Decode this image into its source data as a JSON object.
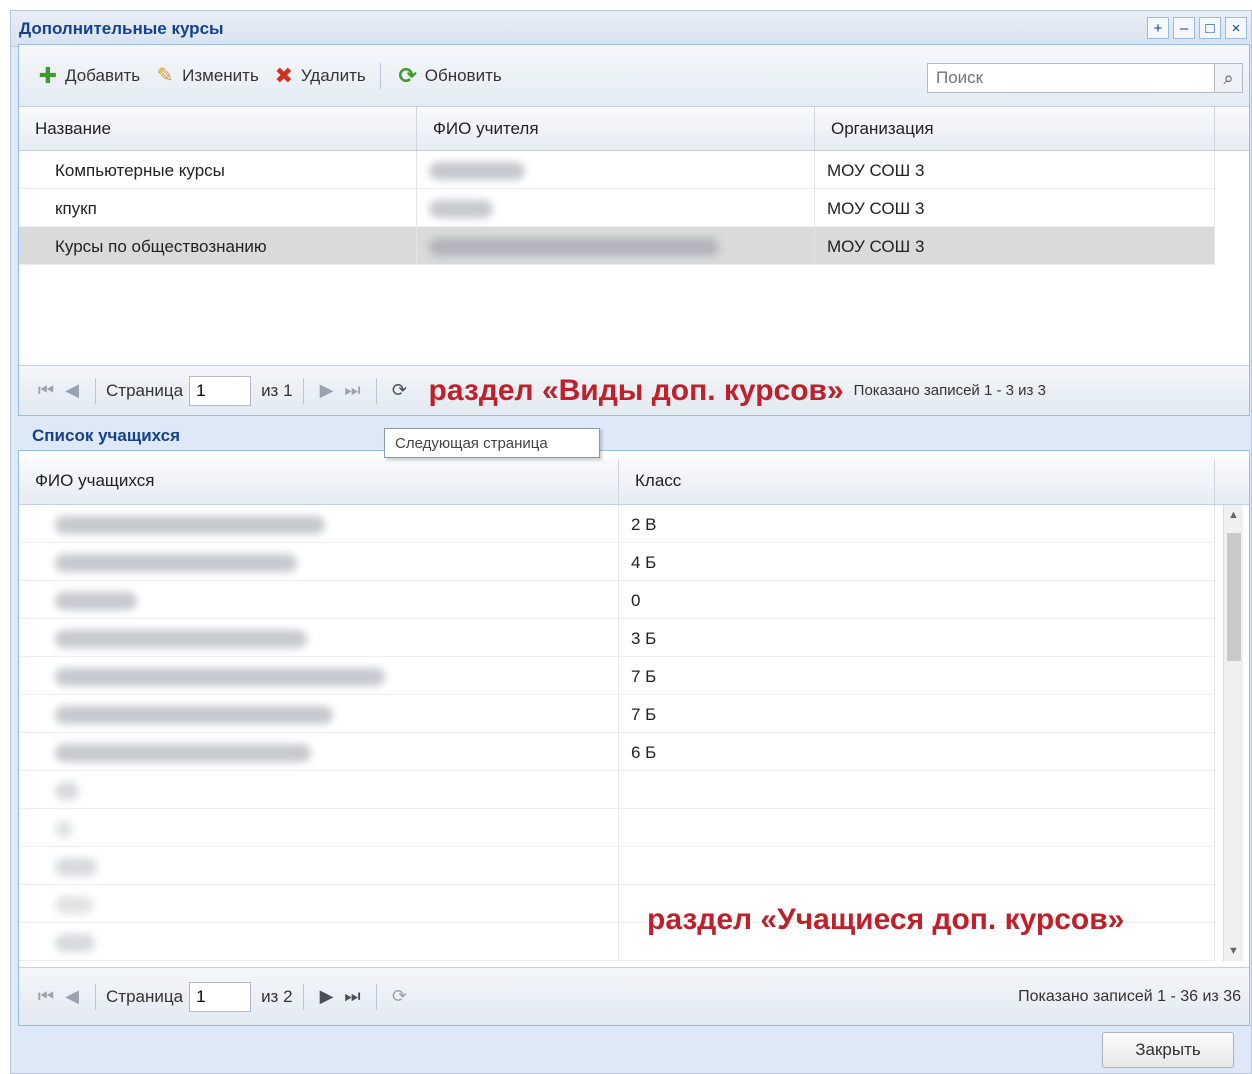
{
  "window": {
    "title": "Дополнительные курсы",
    "tools": [
      "+",
      "–",
      "□",
      "×"
    ]
  },
  "toolbar": {
    "add_label": "Добавить",
    "edit_label": "Изменить",
    "delete_label": "Удалить",
    "refresh_label": "Обновить",
    "search_placeholder": "Поиск"
  },
  "courses_grid": {
    "columns": [
      "Название",
      "ФИО учителя",
      "Организация"
    ],
    "rows": [
      {
        "name": "Компьютерные курсы",
        "org": "МОУ СОШ 3",
        "selected": false
      },
      {
        "name": "кпукп",
        "org": "МОУ СОШ 3",
        "selected": false
      },
      {
        "name": "Курсы по обществознанию",
        "org": "МОУ СОШ 3",
        "selected": true
      }
    ],
    "pager": {
      "page_label": "Страница",
      "page_value": "1",
      "of_label": "из 1",
      "info": "Показано записей 1 - 3 из 3"
    }
  },
  "annotation_top": "раздел «Виды доп. курсов»",
  "students_title": "Список учащихся",
  "tooltip": "Следующая страница",
  "students_grid": {
    "columns": [
      "ФИО учащихся",
      "Класс"
    ],
    "rows": [
      {
        "klass": "2 В"
      },
      {
        "klass": "4 Б"
      },
      {
        "klass": "0"
      },
      {
        "klass": "3 Б"
      },
      {
        "klass": "7 Б"
      },
      {
        "klass": "7 Б"
      },
      {
        "klass": "6 Б"
      },
      {
        "klass": ""
      },
      {
        "klass": ""
      },
      {
        "klass": ""
      },
      {
        "klass": ""
      },
      {
        "klass": ""
      }
    ],
    "pager": {
      "page_label": "Страница",
      "page_value": "1",
      "of_label": "из 2",
      "info": "Показано записей 1 - 36 из 36"
    }
  },
  "annotation_bottom": "раздел «Учащиеся доп. курсов»",
  "close_label": "Закрыть",
  "colors": {
    "accent": "#15428b",
    "annotation_red": "#c0202a",
    "selected_row": "#dadada"
  }
}
